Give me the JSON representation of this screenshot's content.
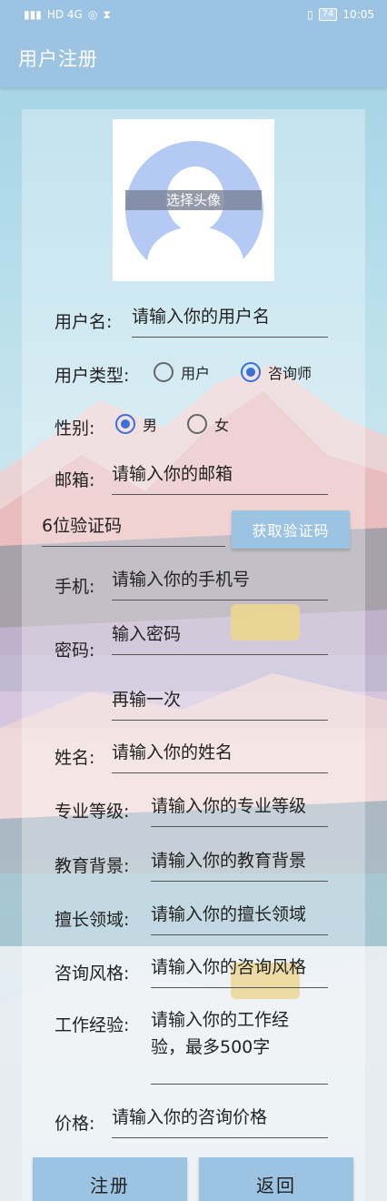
{
  "status_bar": {
    "signal_text": "HD 4G",
    "battery": "74",
    "time": "10:05"
  },
  "appbar": {
    "title": "用户注册"
  },
  "avatar": {
    "label": "选择头像"
  },
  "form": {
    "username_label": "用户名:",
    "username_placeholder": "请输入你的用户名",
    "usertype_label": "用户类型:",
    "usertype_options": [
      "用户",
      "咨询师"
    ],
    "usertype_selected": "咨询师",
    "gender_label": "性别:",
    "gender_options": [
      "男",
      "女"
    ],
    "gender_selected": "男",
    "email_label": "邮箱:",
    "email_placeholder": "请输入你的邮箱",
    "code_placeholder": "6位验证码",
    "get_code_button": "获取验证码",
    "phone_label": "手机:",
    "phone_placeholder": "请输入你的手机号",
    "password_label": "密码:",
    "password_placeholder": "输入密码",
    "password_repeat_placeholder": "再输一次",
    "name_label": "姓名:",
    "name_placeholder": "请输入你的姓名",
    "level_label": "专业等级:",
    "level_placeholder": "请输入你的专业等级",
    "education_label": "教育背景:",
    "education_placeholder": "请输入你的教育背景",
    "field_label": "擅长领域:",
    "field_placeholder": "请输入你的擅长领域",
    "style_label": "咨询风格:",
    "style_placeholder": "请输入你的咨询风格",
    "experience_label": "工作经验:",
    "experience_placeholder_line1": "请输入你的工作经",
    "experience_placeholder_line2": "验，最多500字",
    "price_label": "价格:",
    "price_placeholder": "请输入你的咨询价格"
  },
  "buttons": {
    "register": "注册",
    "back": "返回"
  },
  "colors": {
    "accent": "#9cc4e2",
    "radio": "#3a6fd8"
  }
}
